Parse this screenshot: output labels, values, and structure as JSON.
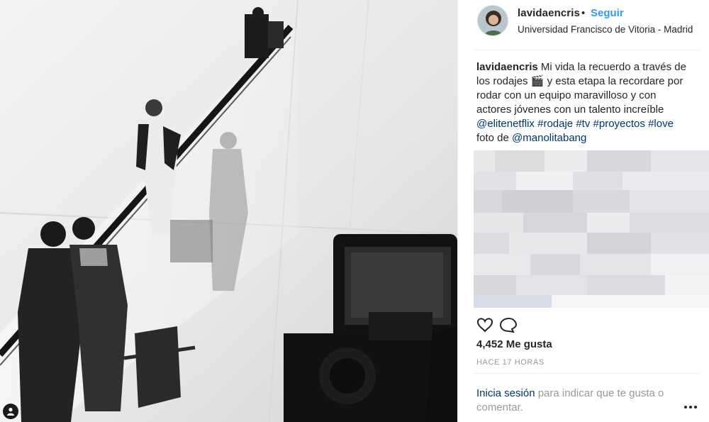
{
  "post": {
    "username": "lavidaencris",
    "separator": "•",
    "follow_label": "Seguir",
    "location": "Universidad Francisco de Vitoria - Madrid"
  },
  "caption": {
    "username": "lavidaencris",
    "line1": "Mi vida la recuerdo a través de",
    "line2a": "los rodajes",
    "line2_emoji": "🎬",
    "line2b": "y esta etapa la recordare por",
    "line3": "rodar con un equipo maravilloso y con",
    "line4": "actores jóvenes con un talento increíble",
    "tags": [
      "@elitenetflix",
      "#rodaje",
      "#tv",
      "#proyectos",
      "#love"
    ],
    "foto_prefix": "foto de",
    "mention": "@manolitabang"
  },
  "likes": "4,452 Me gusta",
  "time": "HACE 17 HORAS",
  "login": {
    "link": "Inicia sesión",
    "text1": "para indicar que te gusta o",
    "text2": "comentar."
  },
  "icons": {
    "like": "heart-icon",
    "comment": "comment-icon",
    "more": "more-options-icon",
    "tagged_user": "user-tag-icon"
  },
  "colors": {
    "link_blue": "#3897f0",
    "hashtag_navy": "#003569",
    "text": "#262626",
    "muted": "#999999"
  }
}
